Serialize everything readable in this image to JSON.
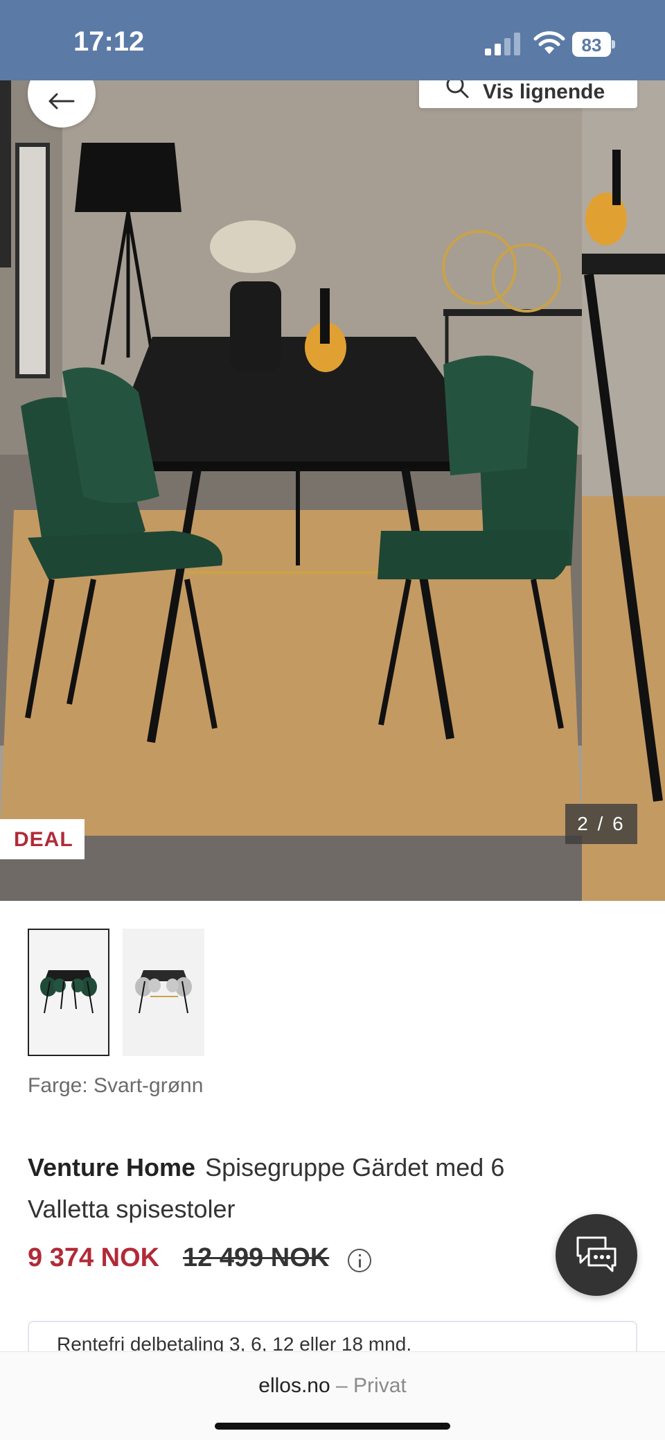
{
  "status_bar": {
    "time": "17:12",
    "battery": "83",
    "background": "#5b7aa6"
  },
  "hero": {
    "similar_label": "Vis lignende",
    "deal_badge": "DEAL",
    "image_counter": "2 / 6"
  },
  "color": {
    "label": "Farge: Svart-grønn"
  },
  "product": {
    "brand": "Venture Home",
    "name": "Spisegruppe Gärdet med 6 Valletta spisestoler",
    "price_now": "9 374 NOK",
    "price_old": "12 499 NOK",
    "accent_color": "#b22a37"
  },
  "promo": {
    "text": "Rentefri delbetaling 3, 6, 12 eller 18 mnd."
  },
  "browser": {
    "domain": "ellos.no",
    "separator": "–",
    "mode": "Privat"
  }
}
